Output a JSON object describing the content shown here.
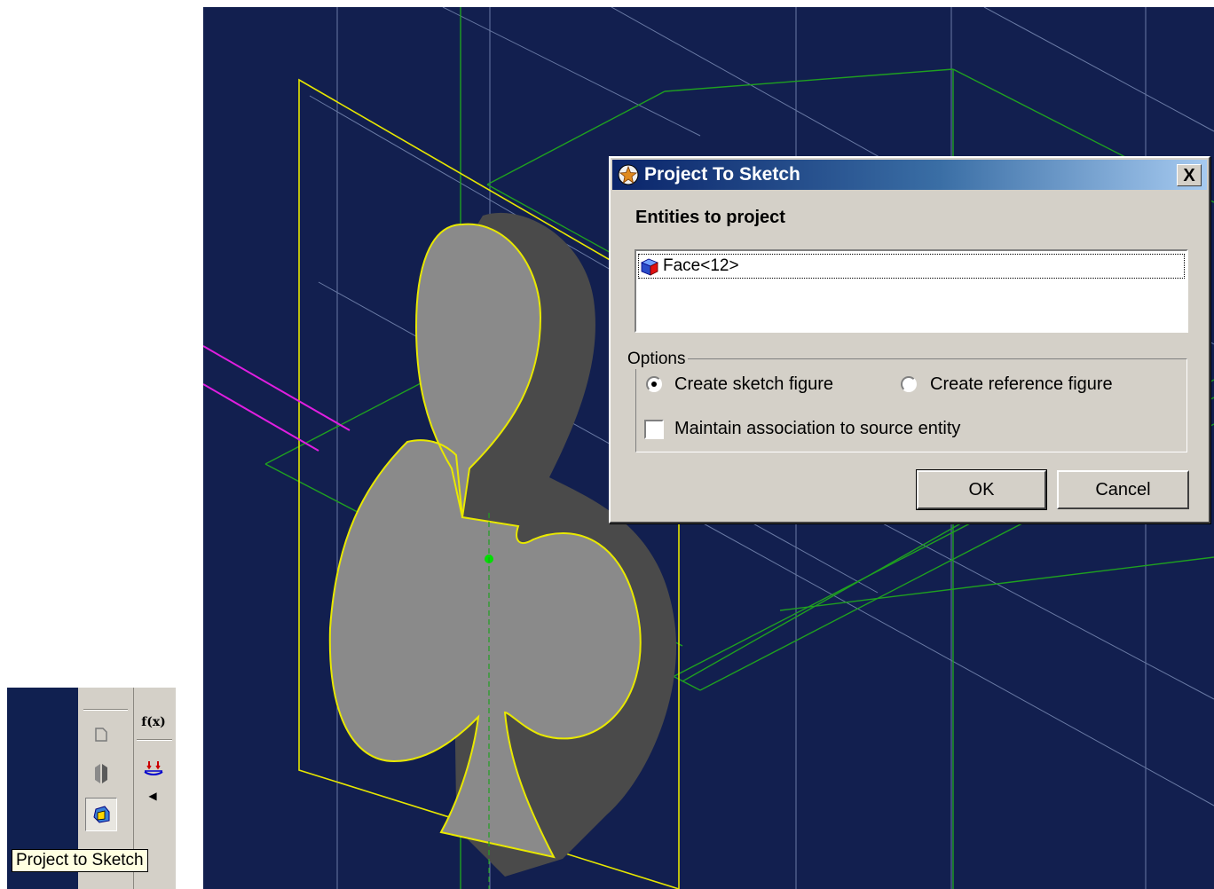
{
  "dialog": {
    "title": "Project To Sketch",
    "close_label": "X",
    "entities_label": "Entities to project",
    "entities": [
      {
        "label": "Face<12>",
        "icon": "face-icon"
      }
    ],
    "options_label": "Options",
    "radio_sketch_label": "Create sketch figure",
    "radio_reference_label": "Create reference figure",
    "selected_option": "Create sketch figure",
    "checkbox_label": "Maintain association to source entity",
    "checkbox_checked": false,
    "ok_label": "OK",
    "cancel_label": "Cancel"
  },
  "toolbar": {
    "tooltip": "Project to Sketch",
    "formula_label": "f(x)",
    "buttons": [
      "sketch-icon",
      "mirror-icon",
      "project-to-sketch-icon",
      "formula-icon",
      "dimension-icon",
      "more-arrow-icon"
    ]
  },
  "colors": {
    "viewport_background": "#121f4f",
    "title_gradient_start": "#0a246a",
    "title_gradient_end": "#a6caf0",
    "highlight_outline": "#ffff00",
    "axis_green": "#00c000",
    "magenta_line": "#ff00ff",
    "dialog_face": "#d4d0c8",
    "tooltip_background": "#ffffe1"
  }
}
